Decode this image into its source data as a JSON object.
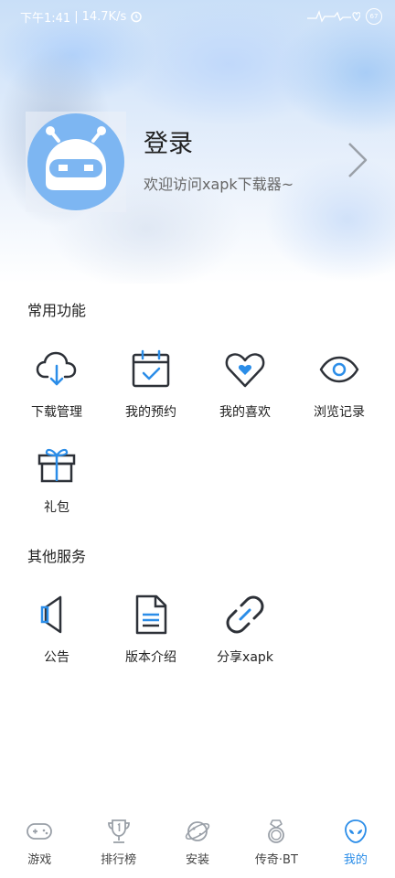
{
  "status_bar": {
    "time": "下午1:41",
    "speed": "14.7K/s",
    "battery": "67"
  },
  "profile": {
    "login_label": "登录",
    "welcome_text": "欢迎访问xapk下载器~"
  },
  "common": {
    "title": "常用功能",
    "items": [
      {
        "label": "下载管理",
        "icon": "cloud-download-icon"
      },
      {
        "label": "我的预约",
        "icon": "calendar-check-icon"
      },
      {
        "label": "我的喜欢",
        "icon": "heart-icon"
      },
      {
        "label": "浏览记录",
        "icon": "eye-icon"
      },
      {
        "label": "礼包",
        "icon": "gift-icon"
      }
    ]
  },
  "other": {
    "title": "其他服务",
    "items": [
      {
        "label": "公告",
        "icon": "speaker-icon"
      },
      {
        "label": "版本介绍",
        "icon": "document-icon"
      },
      {
        "label": "分享xapk",
        "icon": "link-icon"
      }
    ]
  },
  "tabbar": {
    "items": [
      {
        "label": "游戏",
        "icon": "gamepad-icon",
        "active": false
      },
      {
        "label": "排行榜",
        "icon": "trophy-icon",
        "active": false
      },
      {
        "label": "安装",
        "icon": "planet-icon",
        "active": false
      },
      {
        "label": "传奇·BT",
        "icon": "ring-icon",
        "active": false
      },
      {
        "label": "我的",
        "icon": "alien-icon",
        "active": true
      }
    ],
    "active_color": "#2b8de8"
  },
  "colors": {
    "accent": "#2b8de8",
    "avatar_bg": "#7db6f2"
  }
}
